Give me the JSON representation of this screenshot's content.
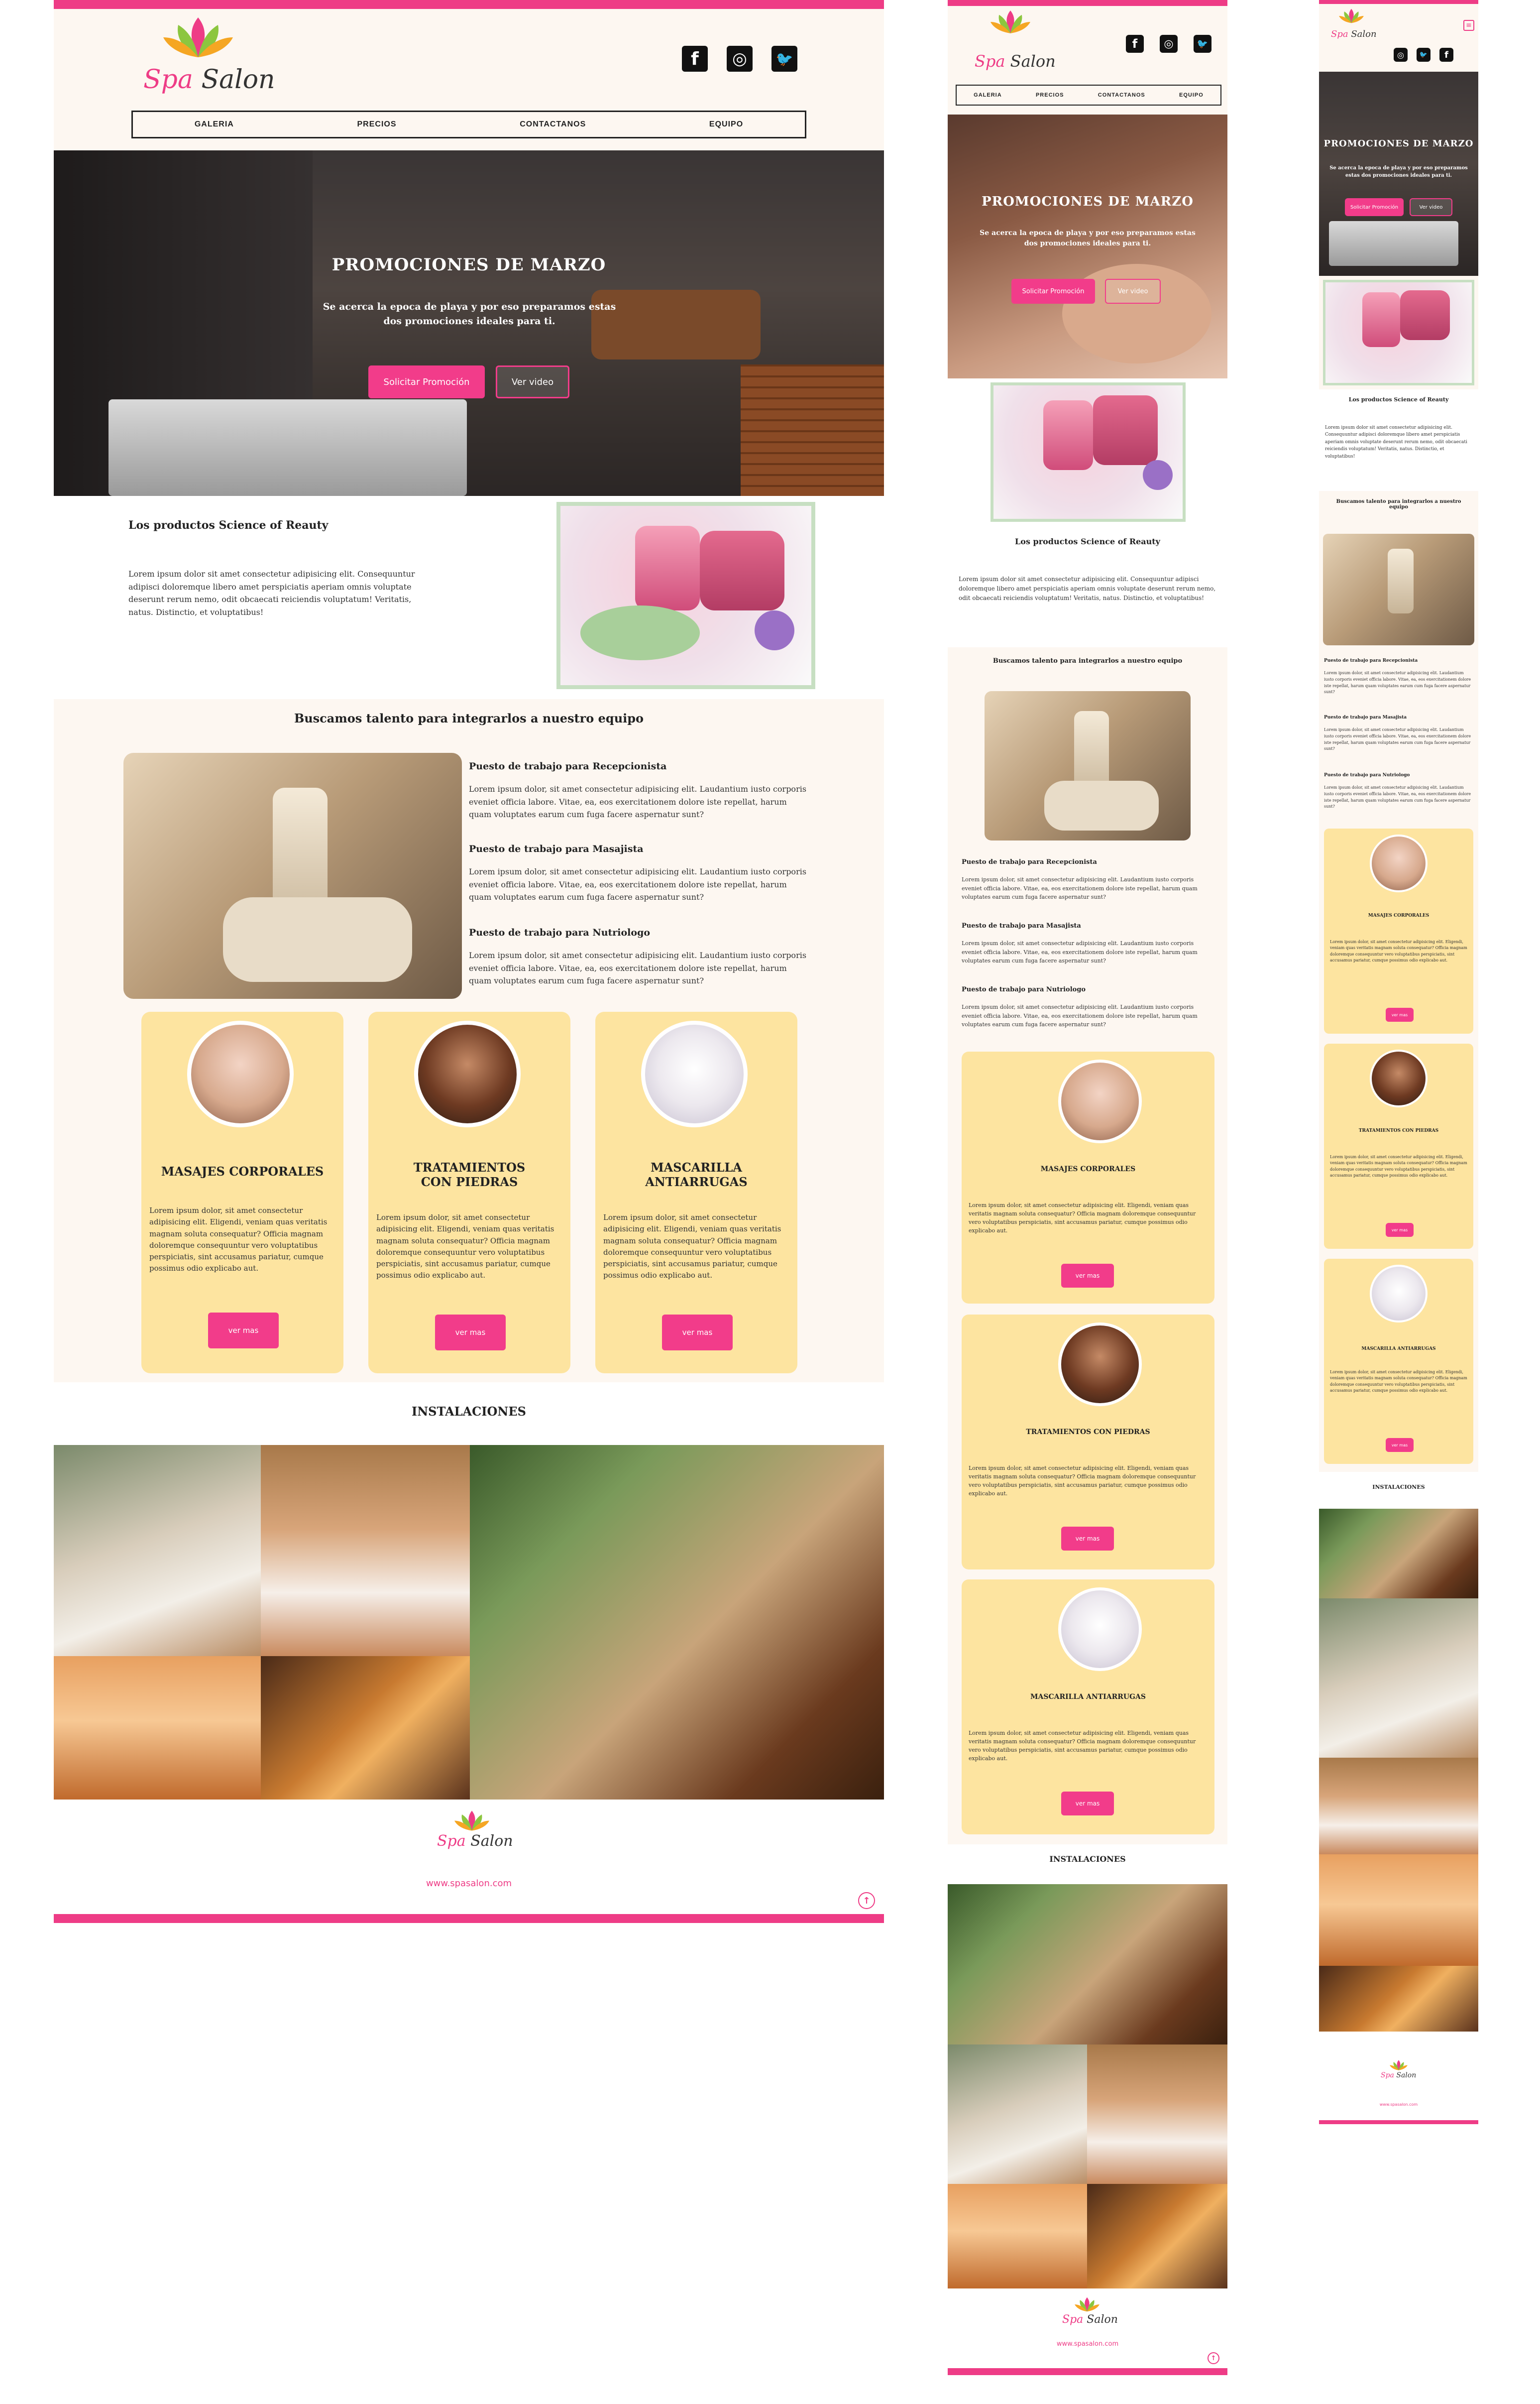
{
  "brand": {
    "spa": "Spa",
    "salon": "Salon",
    "url": "www.spasalon.com"
  },
  "colors": {
    "pink": "#ee3c86",
    "cream": "#fdf7f1",
    "card": "#fde4a0"
  },
  "social": [
    {
      "icon": "facebook-icon",
      "glyph": "f"
    },
    {
      "icon": "instagram-icon",
      "glyph": "◎"
    },
    {
      "icon": "twitter-icon",
      "glyph": "🐦"
    }
  ],
  "nav": {
    "galeria": "GALERIA",
    "precios": "PRECIOS",
    "contactanos": "CONTACTANOS",
    "equipo": "EQUIPO"
  },
  "hero": {
    "title": "PROMOCIONES DE MARZO",
    "subtitle": "Se acerca la epoca de playa y por eso preparamos estas dos promociones ideales para ti.",
    "primary_button": "Solicitar Promoción",
    "secondary_button": "Ver video"
  },
  "products": {
    "title": "Los productos Science of Reauty",
    "text": "Lorem ipsum dolor sit amet consectetur adipisicing elit. Consequuntur adipisci doloremque libero amet perspiciatis aperiam omnis voluptate deserunt rerum nemo, odit obcaecati reiciendis voluptatum! Veritatis, natus. Distinctio, et voluptatibus!"
  },
  "talent": {
    "title": "Buscamos talento para integrarlos a nuestro equipo",
    "jobs": [
      {
        "title": "Puesto de trabajo para Recepcionista",
        "text": "Lorem ipsum dolor, sit amet consectetur adipisicing elit. Laudantium iusto corporis eveniet officia labore. Vitae, ea, eos exercitationem dolore iste repellat, harum quam voluptates earum cum fuga facere aspernatur sunt?"
      },
      {
        "title": "Puesto de trabajo para Masajista",
        "text": "Lorem ipsum dolor, sit amet consectetur adipisicing elit. Laudantium iusto corporis eveniet officia labore. Vitae, ea, eos exercitationem dolore iste repellat, harum quam voluptates earum cum fuga facere aspernatur sunt?"
      },
      {
        "title": "Puesto de trabajo para Nutriologo",
        "text": "Lorem ipsum dolor, sit amet consectetur adipisicing elit. Laudantium iusto corporis eveniet officia labore. Vitae, ea, eos exercitationem dolore iste repellat, harum quam voluptates earum cum fuga facere aspernatur sunt?"
      }
    ]
  },
  "services": [
    {
      "title": "MASAJES CORPORALES",
      "text": "Lorem ipsum dolor, sit amet consectetur adipisicing elit. Eligendi, veniam quas veritatis magnam soluta consequatur? Officia magnam doloremque consequuntur vero voluptatibus perspiciatis, sint accusamus pariatur, cumque possimus odio explicabo aut.",
      "button": "ver mas"
    },
    {
      "title": "TRATAMIENTOS CON PIEDRAS",
      "text": "Lorem ipsum dolor, sit amet consectetur adipisicing elit. Eligendi, veniam quas veritatis magnam soluta consequatur? Officia magnam doloremque consequuntur vero voluptatibus perspiciatis, sint accusamus pariatur, cumque possimus odio explicabo aut.",
      "button": "ver mas"
    },
    {
      "title": "MASCARILLA ANTIARRUGAS",
      "text": "Lorem ipsum dolor, sit amet consectetur adipisicing elit. Eligendi, veniam quas veritatis magnam soluta consequatur? Officia magnam doloremque consequuntur vero voluptatibus perspiciatis, sint accusamus pariatur, cumque possimus odio explicabo aut.",
      "button": "ver mas"
    }
  ],
  "facilities": {
    "title": "INSTALACIONES"
  },
  "scroll_top": "↑"
}
